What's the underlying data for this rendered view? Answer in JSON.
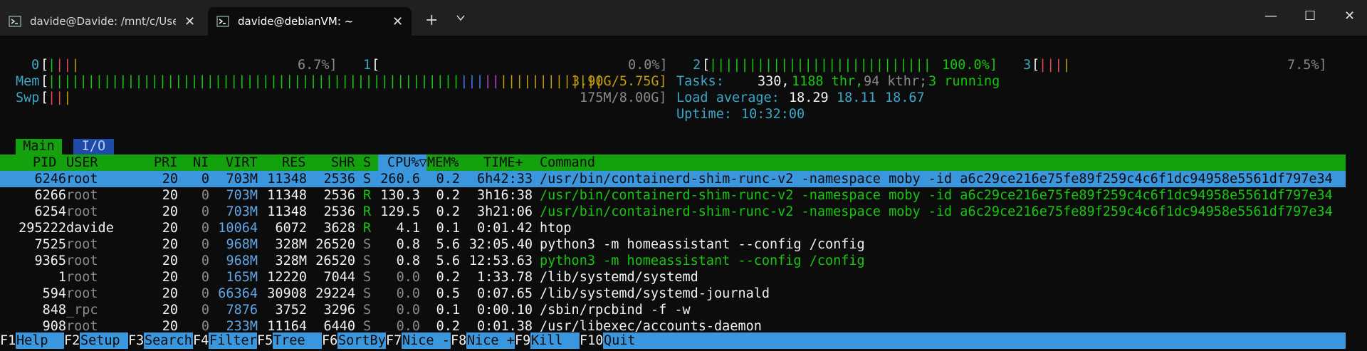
{
  "window": {
    "tabs": [
      {
        "title": "davide@Davide: /mnt/c/Users,",
        "active": false
      },
      {
        "title": "davide@debianVM: ~",
        "active": true
      }
    ],
    "new_tab": "+",
    "controls": {
      "minimize": "—",
      "maximize": "☐",
      "close": "✕"
    }
  },
  "meters": {
    "cpu": [
      {
        "id": "0",
        "value": "6.7%]"
      },
      {
        "id": "1",
        "value": "0.0%]"
      },
      {
        "id": "2",
        "value": "100.0%]"
      },
      {
        "id": "3",
        "value": "7.5%]"
      }
    ],
    "mem": {
      "label": "Mem",
      "value": "3.90G/5.75G]"
    },
    "swp": {
      "label": "Swp",
      "value": "175M/8.00G]"
    },
    "tasks": {
      "label": "Tasks:",
      "count": "330,",
      "thr": "1188 thr,",
      "kthr": "94 kthr;",
      "running": "3 running"
    },
    "load": {
      "label": "Load average:",
      "v1": "18.29",
      "v2": "18.11",
      "v3": "18.67"
    },
    "uptime": {
      "label": "Uptime:",
      "value": "10:32:00"
    }
  },
  "screen_tabs": [
    "Main",
    "I/O"
  ],
  "columns": [
    "PID",
    "USER",
    "PRI",
    "NI",
    "VIRT",
    "RES",
    "SHR",
    "S",
    "CPU%▽",
    "MEM%",
    "TIME+",
    "Command"
  ],
  "processes": [
    {
      "pid": "6246",
      "user": "root",
      "pri": "20",
      "ni": "0",
      "virt": "703M",
      "res": "11348",
      "shr": "2536",
      "s": "S",
      "cpu": "260.6",
      "mem": "0.2",
      "time": "6h42:33",
      "cmd": "/usr/bin/containerd-shim-runc-v2 -namespace moby -id a6c29ce216e75fe89f259c4c6f1dc94958e5561df797e34"
    },
    {
      "pid": "6266",
      "user": "root",
      "pri": "20",
      "ni": "0",
      "virt": "703M",
      "res": "11348",
      "shr": "2536",
      "s": "R",
      "cpu": "130.3",
      "mem": "0.2",
      "time": "3h16:38",
      "cmd": "/usr/bin/containerd-shim-runc-v2 -namespace moby -id a6c29ce216e75fe89f259c4c6f1dc94958e5561df797e34"
    },
    {
      "pid": "6254",
      "user": "root",
      "pri": "20",
      "ni": "0",
      "virt": "703M",
      "res": "11348",
      "shr": "2536",
      "s": "R",
      "cpu": "129.5",
      "mem": "0.2",
      "time": "3h21:06",
      "cmd": "/usr/bin/containerd-shim-runc-v2 -namespace moby -id a6c29ce216e75fe89f259c4c6f1dc94958e5561df797e34"
    },
    {
      "pid": "295222",
      "user": "davide",
      "pri": "20",
      "ni": "0",
      "virt": "10064",
      "res": "6072",
      "shr": "3628",
      "s": "R",
      "cpu": "4.1",
      "mem": "0.1",
      "time": "0:01.42",
      "cmd": "htop"
    },
    {
      "pid": "7525",
      "user": "root",
      "pri": "20",
      "ni": "0",
      "virt": "968M",
      "res": "328M",
      "shr": "26520",
      "s": "S",
      "cpu": "0.8",
      "mem": "5.6",
      "time": "32:05.40",
      "cmd": "python3 -m homeassistant --config /config"
    },
    {
      "pid": "9365",
      "user": "root",
      "pri": "20",
      "ni": "0",
      "virt": "968M",
      "res": "328M",
      "shr": "26520",
      "s": "S",
      "cpu": "0.8",
      "mem": "5.6",
      "time": "12:53.63",
      "cmd": "python3 -m homeassistant --config /config"
    },
    {
      "pid": "1",
      "user": "root",
      "pri": "20",
      "ni": "0",
      "virt": "165M",
      "res": "12220",
      "shr": "7044",
      "s": "S",
      "cpu": "0.0",
      "mem": "0.2",
      "time": "1:33.78",
      "cmd": "/lib/systemd/systemd"
    },
    {
      "pid": "594",
      "user": "root",
      "pri": "20",
      "ni": "0",
      "virt": "66364",
      "res": "30908",
      "shr": "29224",
      "s": "S",
      "cpu": "0.0",
      "mem": "0.5",
      "time": "0:07.65",
      "cmd": "/lib/systemd/systemd-journald"
    },
    {
      "pid": "848",
      "user": "_rpc",
      "pri": "20",
      "ni": "0",
      "virt": "7876",
      "res": "3752",
      "shr": "3296",
      "s": "S",
      "cpu": "0.0",
      "mem": "0.1",
      "time": "0:00.10",
      "cmd": "/sbin/rpcbind -f -w"
    },
    {
      "pid": "908",
      "user": "root",
      "pri": "20",
      "ni": "0",
      "virt": "233M",
      "res": "11164",
      "shr": "6440",
      "s": "S",
      "cpu": "0.0",
      "mem": "0.2",
      "time": "0:01.38",
      "cmd": "/usr/libexec/accounts-daemon"
    }
  ],
  "function_keys": [
    {
      "key": "F1",
      "label": "Help"
    },
    {
      "key": "F2",
      "label": "Setup"
    },
    {
      "key": "F3",
      "label": "Search"
    },
    {
      "key": "F4",
      "label": "Filter"
    },
    {
      "key": "F5",
      "label": "Tree"
    },
    {
      "key": "F6",
      "label": "SortBy"
    },
    {
      "key": "F7",
      "label": "Nice -"
    },
    {
      "key": "F8",
      "label": "Nice +"
    },
    {
      "key": "F9",
      "label": "Kill"
    },
    {
      "key": "F10",
      "label": "Quit"
    }
  ]
}
